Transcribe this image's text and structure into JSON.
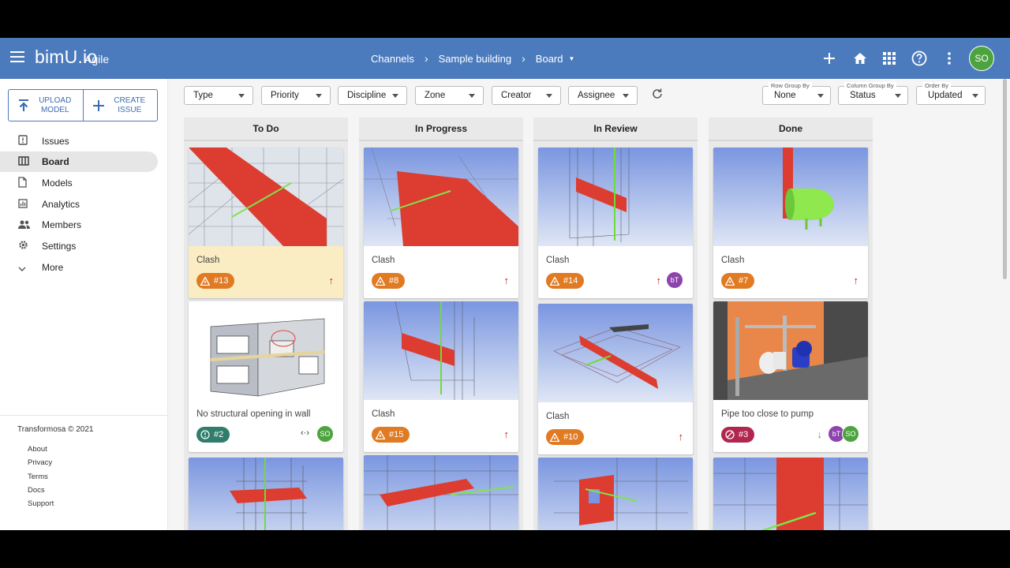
{
  "app": {
    "logo": "bimU.io",
    "logo_sub": "Agile"
  },
  "breadcrumb": [
    "Channels",
    "Sample building",
    "Board"
  ],
  "user": {
    "initials": "SO"
  },
  "sidebar": {
    "upload_line1": "UPLOAD",
    "upload_line2": "MODEL",
    "create_line1": "CREATE",
    "create_line2": "ISSUE",
    "items": [
      {
        "label": "Issues",
        "icon": "issues-icon"
      },
      {
        "label": "Board",
        "icon": "board-icon",
        "active": true
      },
      {
        "label": "Models",
        "icon": "file-icon"
      },
      {
        "label": "Analytics",
        "icon": "analytics-icon"
      },
      {
        "label": "Members",
        "icon": "members-icon"
      },
      {
        "label": "Settings",
        "icon": "gear-icon"
      },
      {
        "label": "More",
        "icon": "chevron-down-icon"
      }
    ],
    "copyright": "Transformosa © 2021",
    "footer_links": [
      "About",
      "Privacy",
      "Terms",
      "Docs",
      "Support"
    ]
  },
  "filters": [
    "Type",
    "Priority",
    "Discipline",
    "Zone",
    "Creator",
    "Assignee"
  ],
  "grouping": [
    {
      "label": "Row Group By",
      "value": "None"
    },
    {
      "label": "Column Group By",
      "value": "Status"
    },
    {
      "label": "Order By",
      "value": "Updated"
    }
  ],
  "columns": [
    {
      "title": "To Do",
      "cards": [
        {
          "title": "Clash",
          "number": "#13",
          "badge_color": "#e07b24",
          "type_icon": "clash-icon",
          "priority": "high"
        },
        {
          "title": "No structural opening in wall",
          "number": "#2",
          "badge_color": "#2f7d6a",
          "type_icon": "alert-icon",
          "assignees": [
            "SO"
          ]
        },
        {
          "title": "",
          "number": ""
        }
      ]
    },
    {
      "title": "In Progress",
      "cards": [
        {
          "title": "Clash",
          "number": "#8",
          "badge_color": "#e07b24",
          "type_icon": "clash-icon",
          "priority": "high"
        },
        {
          "title": "Clash",
          "number": "#15",
          "badge_color": "#e07b24",
          "type_icon": "clash-icon",
          "priority": "high"
        },
        {
          "title": "",
          "number": ""
        }
      ]
    },
    {
      "title": "In Review",
      "cards": [
        {
          "title": "Clash",
          "number": "#14",
          "badge_color": "#e07b24",
          "type_icon": "clash-icon",
          "priority": "high",
          "assignees": [
            "bT"
          ]
        },
        {
          "title": "Clash",
          "number": "#10",
          "badge_color": "#e07b24",
          "type_icon": "clash-icon",
          "priority": "high"
        },
        {
          "title": "",
          "number": ""
        }
      ]
    },
    {
      "title": "Done",
      "cards": [
        {
          "title": "Clash",
          "number": "#7",
          "badge_color": "#e07b24",
          "type_icon": "clash-icon",
          "priority": "high"
        },
        {
          "title": "Pipe too close to pump",
          "number": "#3",
          "badge_color": "#b0264f",
          "type_icon": "blocked-icon",
          "priority": "low",
          "assignees": [
            "bT",
            "SO"
          ]
        },
        {
          "title": "",
          "number": ""
        }
      ]
    }
  ]
}
